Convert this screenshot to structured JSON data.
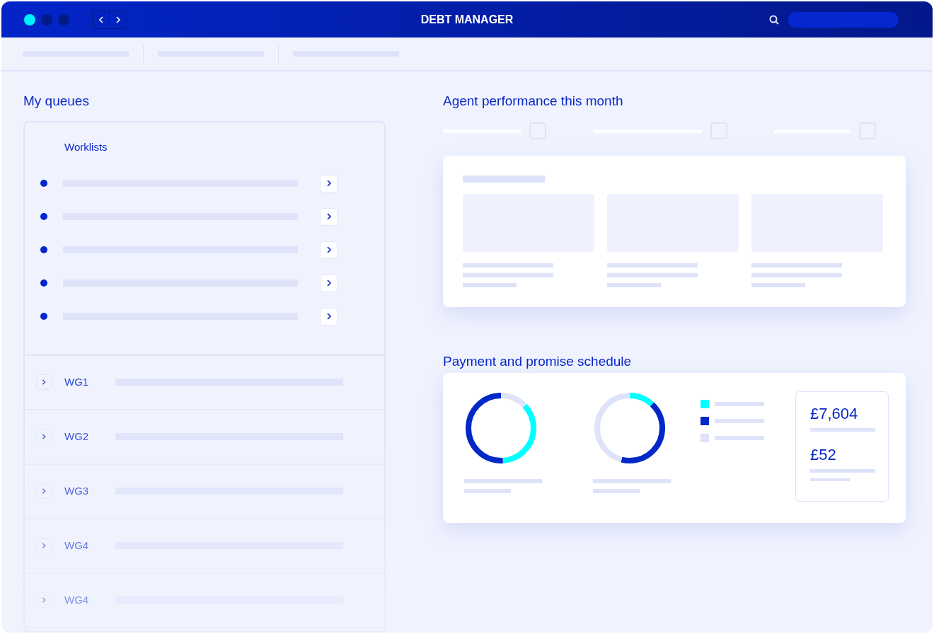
{
  "window": {
    "title": "DEBT MANAGER",
    "dots": [
      {
        "color": "#00f0ff"
      },
      {
        "color": "#021a86"
      },
      {
        "color": "#021a86"
      }
    ]
  },
  "queues": {
    "title": "My queues",
    "worklists_title": "Worklists",
    "groups": [
      {
        "label": "WG1"
      },
      {
        "label": "WG2"
      },
      {
        "label": "WG3"
      },
      {
        "label": "WG4"
      },
      {
        "label": "WG4"
      }
    ]
  },
  "performance": {
    "title": "Agent performance this month",
    "filters": [
      {
        "checked": false
      },
      {
        "checked": false
      },
      {
        "checked": false
      }
    ]
  },
  "schedule": {
    "title": "Payment and promise schedule",
    "legend": [
      {
        "color": "#00ffff"
      },
      {
        "color": "#0328c8"
      },
      {
        "color": "#dfe3fa"
      }
    ],
    "amounts": [
      "£7,604",
      "£52"
    ]
  }
}
